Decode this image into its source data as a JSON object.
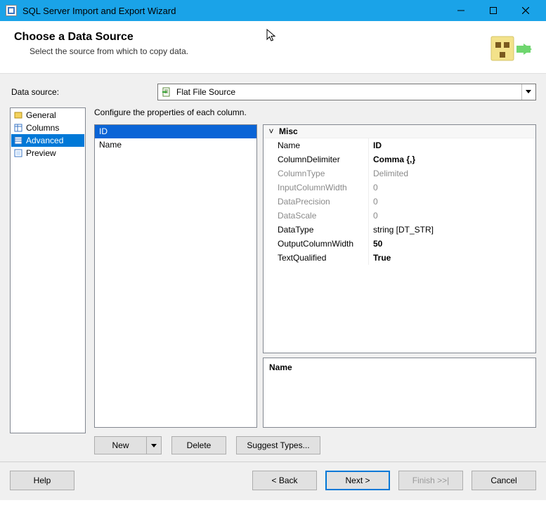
{
  "window": {
    "title": "SQL Server Import and Export Wizard"
  },
  "header": {
    "title": "Choose a Data Source",
    "subtitle": "Select the source from which to copy data."
  },
  "data_source": {
    "label": "Data source:",
    "selected": "Flat File Source"
  },
  "nav": {
    "items": [
      {
        "label": "General"
      },
      {
        "label": "Columns"
      },
      {
        "label": "Advanced",
        "selected": true
      },
      {
        "label": "Preview"
      }
    ]
  },
  "instruction": "Configure the properties of each column.",
  "column_list": [
    {
      "name": "ID",
      "selected": true
    },
    {
      "name": "Name"
    }
  ],
  "property_grid": {
    "category": "Misc",
    "rows": [
      {
        "name": "Name",
        "value": "ID",
        "bold": true
      },
      {
        "name": "ColumnDelimiter",
        "value": "Comma {,}",
        "bold": true
      },
      {
        "name": "ColumnType",
        "value": "Delimited",
        "disabled": true
      },
      {
        "name": "InputColumnWidth",
        "value": "0",
        "disabled": true
      },
      {
        "name": "DataPrecision",
        "value": "0",
        "disabled": true
      },
      {
        "name": "DataScale",
        "value": "0",
        "disabled": true
      },
      {
        "name": "DataType",
        "value": "string [DT_STR]"
      },
      {
        "name": "OutputColumnWidth",
        "value": "50",
        "bold": true
      },
      {
        "name": "TextQualified",
        "value": "True",
        "bold": true
      }
    ],
    "description_title": "Name"
  },
  "column_buttons": {
    "new": "New",
    "delete": "Delete",
    "suggest": "Suggest Types..."
  },
  "wizard_buttons": {
    "help": "Help",
    "back": "< Back",
    "next": "Next >",
    "finish": "Finish >>|",
    "cancel": "Cancel"
  }
}
